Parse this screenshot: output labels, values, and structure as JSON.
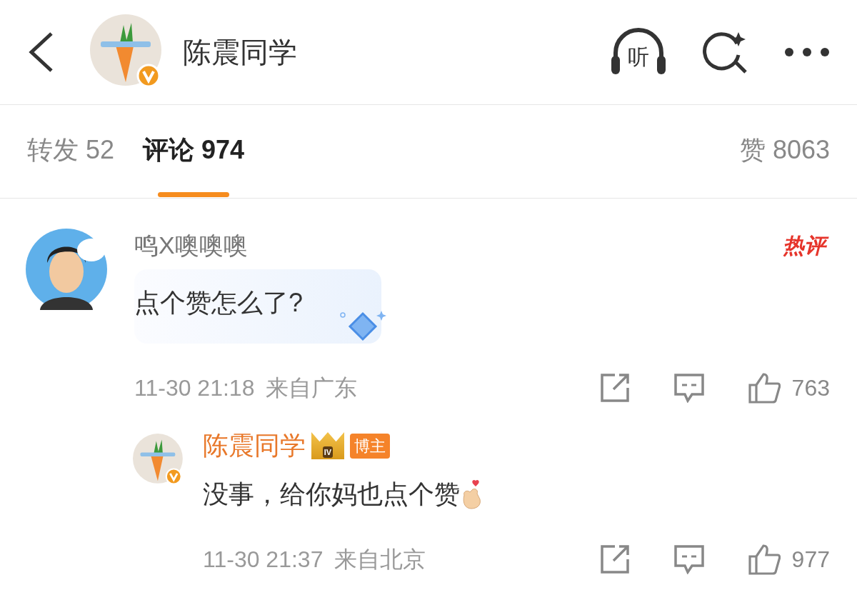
{
  "header": {
    "title": "陈震同学",
    "verified": true,
    "listen_label": "听"
  },
  "tabs": [
    {
      "label": "转发 52",
      "selected": false
    },
    {
      "label": "评论 974",
      "selected": true
    }
  ],
  "likes_tab": {
    "label": "赞 8063"
  },
  "comments": [
    {
      "author": "鸣X噢噢噢",
      "hot_label": "热评",
      "text": "点个赞怎么了?",
      "time": "11-30 21:18",
      "location": "来自广东",
      "likes": "763",
      "replies": [
        {
          "author": "陈震同学",
          "verified": true,
          "badge_level": "IV",
          "badge": "博主",
          "text": "没事，给你妈也点个赞",
          "time": "11-30 21:37",
          "location": "来自北京",
          "likes": "977"
        }
      ]
    }
  ]
}
